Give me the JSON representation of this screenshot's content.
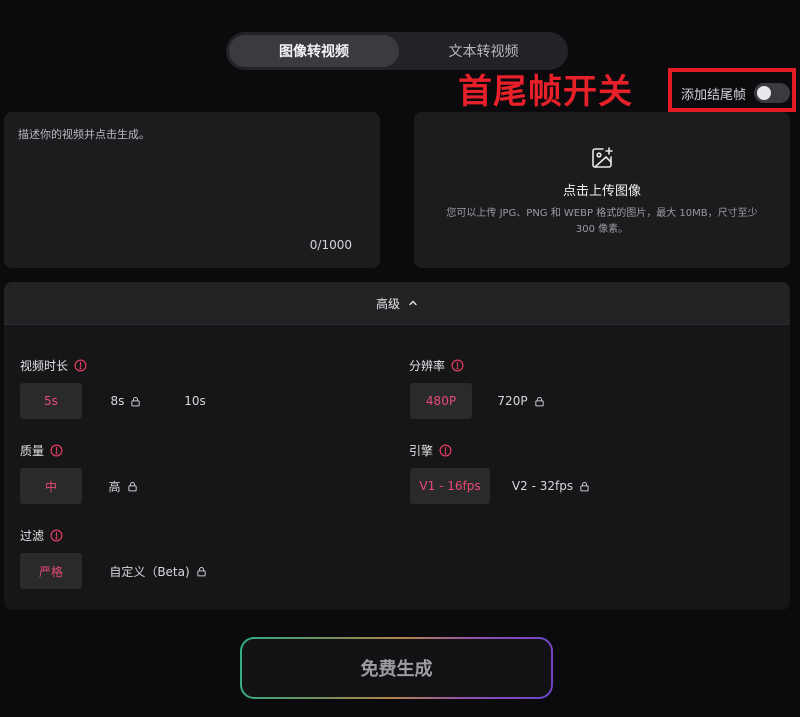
{
  "mode_tabs": [
    {
      "label": "图像转视频",
      "active": true
    },
    {
      "label": "文本转视频",
      "active": false
    }
  ],
  "annotation": {
    "text": "首尾帧开关",
    "color": "#e8202a"
  },
  "end_frame": {
    "label": "添加结尾帧",
    "enabled": false
  },
  "prompt": {
    "placeholder": "描述你的视频并点击生成。",
    "value": "",
    "counter": "0/1000"
  },
  "upload": {
    "icon": "image-plus-icon",
    "title": "点击上传图像",
    "hint": "您可以上传 JPG、PNG 和 WEBP 格式的图片，最大 10MB，尺寸至少 300 像素。"
  },
  "advanced": {
    "title": "高级",
    "sections": {
      "duration": {
        "label": "视频时长",
        "options": [
          {
            "label": "5s",
            "selected": true,
            "locked": false
          },
          {
            "label": "8s",
            "selected": false,
            "locked": true
          },
          {
            "label": "10s",
            "selected": false,
            "locked": false
          }
        ]
      },
      "resolution": {
        "label": "分辨率",
        "options": [
          {
            "label": "480P",
            "selected": true,
            "locked": false
          },
          {
            "label": "720P",
            "selected": false,
            "locked": true
          }
        ]
      },
      "quality": {
        "label": "质量",
        "options": [
          {
            "label": "中",
            "selected": true,
            "locked": false
          },
          {
            "label": "高",
            "selected": false,
            "locked": true
          }
        ]
      },
      "engine": {
        "label": "引擎",
        "options": [
          {
            "label": "V1 - 16fps",
            "selected": true,
            "locked": false
          },
          {
            "label": "V2 - 32fps",
            "selected": false,
            "locked": true
          }
        ]
      },
      "filter": {
        "label": "过滤",
        "options": [
          {
            "label": "严格",
            "selected": true,
            "locked": false
          },
          {
            "label": "自定义（Beta)",
            "selected": false,
            "locked": true
          }
        ]
      }
    }
  },
  "generate_button": {
    "label": "免费生成"
  },
  "colors": {
    "accent": "#e84a72",
    "info": "#e03d5f",
    "background": "#0b0a0d"
  }
}
